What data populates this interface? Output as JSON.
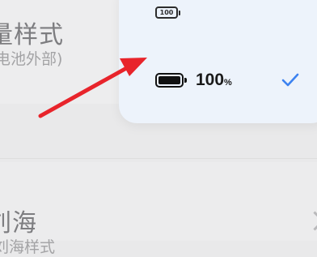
{
  "background_rows": {
    "battery_style": {
      "title": "量样式",
      "subtitle": "电池外部)"
    },
    "notch": {
      "title": "刘海",
      "subtitle": "刘海样式"
    }
  },
  "popup": {
    "options": [
      {
        "icon": "battery-with-number-inside-icon",
        "label": "100",
        "selected": false
      },
      {
        "icon": "battery-full-icon",
        "value": "100",
        "unit": "%",
        "selected": true
      }
    ]
  },
  "colors": {
    "popup_bg": "#edf3fb",
    "check": "#3c82f0",
    "arrow": "#e8242b"
  }
}
